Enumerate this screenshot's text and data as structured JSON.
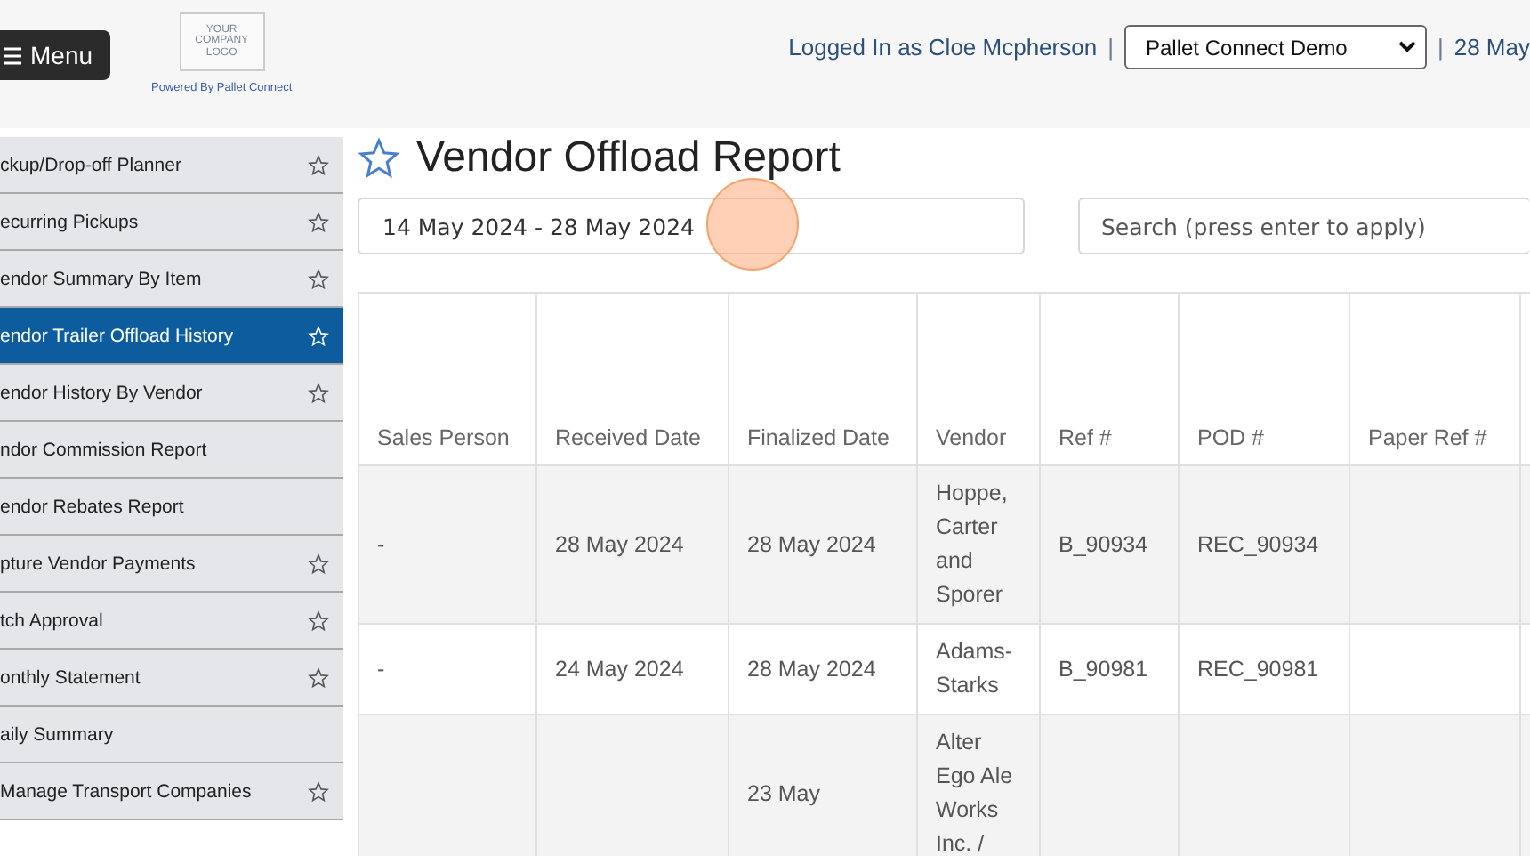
{
  "header": {
    "menu_button": "Menu",
    "logo_lines": [
      "YOUR",
      "COMPANY",
      "LOGO"
    ],
    "powered_by": "Powered By Pallet Connect",
    "logged_in": "Logged In as Cloe Mcpherson",
    "separator": "|",
    "company_select": "Pallet Connect Demo",
    "date_separator": "|",
    "date": "28 May"
  },
  "sidebar": {
    "items": [
      {
        "label": "ckup/Drop-off Planner",
        "star": true,
        "selected": false
      },
      {
        "label": "ecurring Pickups",
        "star": true,
        "selected": false
      },
      {
        "label": "endor Summary By Item",
        "star": true,
        "selected": false
      },
      {
        "label": "endor Trailer Offload History",
        "star": true,
        "selected": true
      },
      {
        "label": "endor History By Vendor",
        "star": true,
        "selected": false
      },
      {
        "label": "ndor Commission Report",
        "star": false,
        "selected": false
      },
      {
        "label": "endor Rebates Report",
        "star": false,
        "selected": false
      },
      {
        "label": "pture Vendor Payments",
        "star": true,
        "selected": false
      },
      {
        "label": "tch Approval",
        "star": true,
        "selected": false
      },
      {
        "label": "onthly Statement",
        "star": true,
        "selected": false
      },
      {
        "label": "aily Summary",
        "star": false,
        "selected": false
      },
      {
        "label": "Manage Transport Companies",
        "star": true,
        "selected": false
      }
    ]
  },
  "page": {
    "title": "Vendor Offload Report",
    "date_range": "14 May 2024 - 28 May 2024",
    "search": {
      "placeholder": "Search (press enter to apply)"
    }
  },
  "table": {
    "columns": [
      "Sales Person",
      "Received Date",
      "Finalized Date",
      "Vendor",
      "Ref #",
      "POD #",
      "Paper Ref #"
    ],
    "rows": [
      [
        "-",
        "28 May 2024",
        "28 May 2024",
        "Hoppe, Carter and Sporer",
        "B_90934",
        "REC_90934",
        ""
      ],
      [
        "-",
        "24 May 2024",
        "28 May 2024",
        "Adams-Starks",
        "B_90981",
        "REC_90981",
        ""
      ],
      [
        "",
        "",
        "23 May",
        "Alter Ego Ale Works Inc. /",
        "",
        "",
        ""
      ]
    ]
  }
}
